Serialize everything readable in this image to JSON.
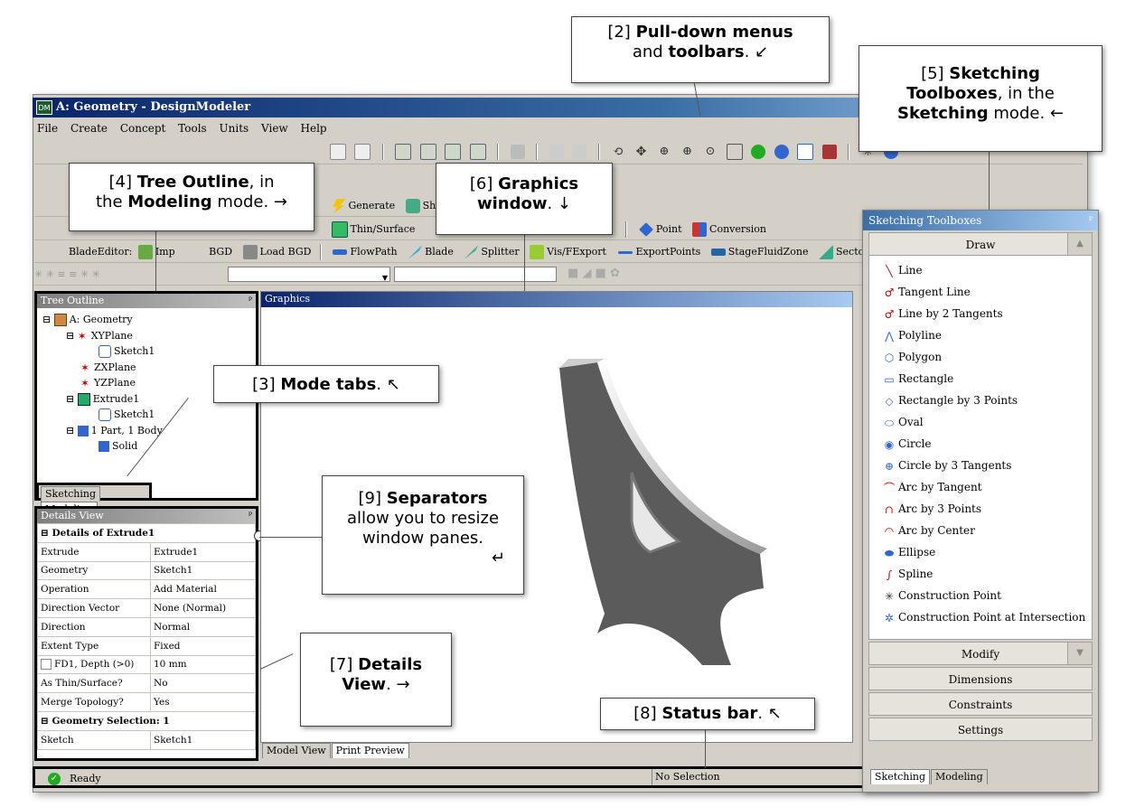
{
  "window": {
    "title": "A: Geometry - DesignModeler",
    "icon": "DM"
  },
  "menu": [
    "File",
    "Create",
    "Concept",
    "Tools",
    "Units",
    "View",
    "Help"
  ],
  "toolbar": {
    "row3": {
      "generate": "Generate",
      "share": "Sha"
    },
    "row4": {
      "thin_surface": "Thin/Surface",
      "point": "Point",
      "conversion": "Conversion"
    },
    "row5": {
      "prefix": "BladeEditor:",
      "import": "Imp",
      "bgd": "BGD",
      "load_bgd": "Load BGD",
      "flowpath": "FlowPath",
      "blade": "Blade",
      "splitter": "Splitter",
      "vis": "Vis",
      "export": "/FExport",
      "export_points": "ExportPoints",
      "stage_fluid_zone": "StageFluidZone",
      "sector": "SectorC"
    }
  },
  "tree": {
    "title": "Tree Outline",
    "items": [
      "A: Geometry",
      "XYPlane",
      "Sketch1",
      "ZXPlane",
      "YZPlane",
      "Extrude1",
      "Sketch1",
      "1 Part, 1 Body",
      "Solid"
    ]
  },
  "mode_tabs": [
    "Sketching",
    "Modeling"
  ],
  "details": {
    "title": "Details View",
    "header": "Details of Extrude1",
    "rows": [
      [
        "Extrude",
        "Extrude1"
      ],
      [
        "Geometry",
        "Sketch1"
      ],
      [
        "Operation",
        "Add Material"
      ],
      [
        "Direction Vector",
        "None (Normal)"
      ],
      [
        "Direction",
        "Normal"
      ],
      [
        "Extent Type",
        "Fixed"
      ],
      [
        "FD1, Depth (>0)",
        "10 mm"
      ],
      [
        "As Thin/Surface?",
        "No"
      ],
      [
        "Merge Topology?",
        "Yes"
      ]
    ],
    "section2": "Geometry Selection: 1",
    "rows2": [
      [
        "Sketch",
        "Sketch1"
      ]
    ]
  },
  "graphics": {
    "title": "Graphics",
    "tabs": [
      "Model View",
      "Print Preview"
    ]
  },
  "status": {
    "text": "Ready",
    "selection": "No Selection"
  },
  "sketching_toolboxes": {
    "title": "Sketching Toolboxes",
    "draw": "Draw",
    "tools": [
      "Line",
      "Tangent Line",
      "Line by 2 Tangents",
      "Polyline",
      "Polygon",
      "Rectangle",
      "Rectangle by 3 Points",
      "Oval",
      "Circle",
      "Circle by 3 Tangents",
      "Arc by Tangent",
      "Arc by 3 Points",
      "Arc by Center",
      "Ellipse",
      "Spline",
      "Construction Point",
      "Construction Point at Intersection"
    ],
    "sections": [
      "Modify",
      "Dimensions",
      "Constraints",
      "Settings"
    ],
    "tabs": [
      "Sketching",
      "Modeling"
    ]
  },
  "callouts": {
    "c2": {
      "num": "[2]",
      "bold1": "Pull-down menus",
      "t1": "and",
      "bold2": "toolbars",
      "t2": ". ↙"
    },
    "c3": {
      "num": "[3]",
      "bold": "Mode tabs",
      "t": ". ↖"
    },
    "c4": {
      "num": "[4]",
      "bold1": "Tree Outline",
      "t1": ", in",
      "t2": "the",
      "bold2": "Modeling",
      "t3": "mode. →"
    },
    "c5": {
      "num": "[5]",
      "bold1": "Sketching",
      "bold2": "Toolboxes",
      "t1": ", in the",
      "bold3": "Sketching",
      "t2": "mode. ←"
    },
    "c6": {
      "num": "[6]",
      "bold1": "Graphics",
      "bold2": "window",
      "t": ". ↓"
    },
    "c7": {
      "num": "[7]",
      "bold1": "Details",
      "bold2": "View",
      "t": ". →"
    },
    "c8": {
      "num": "[8]",
      "bold": "Status bar",
      "t": ". ↖"
    },
    "c9": {
      "num": "[9]",
      "bold": "Separators",
      "t1": "allow you to resize",
      "t2": "window panes.",
      "t3": "↵"
    }
  },
  "colors": {
    "title_blue": "#0a246a",
    "face": "#d4d0c8",
    "model_gray": "#5a5a5a"
  }
}
